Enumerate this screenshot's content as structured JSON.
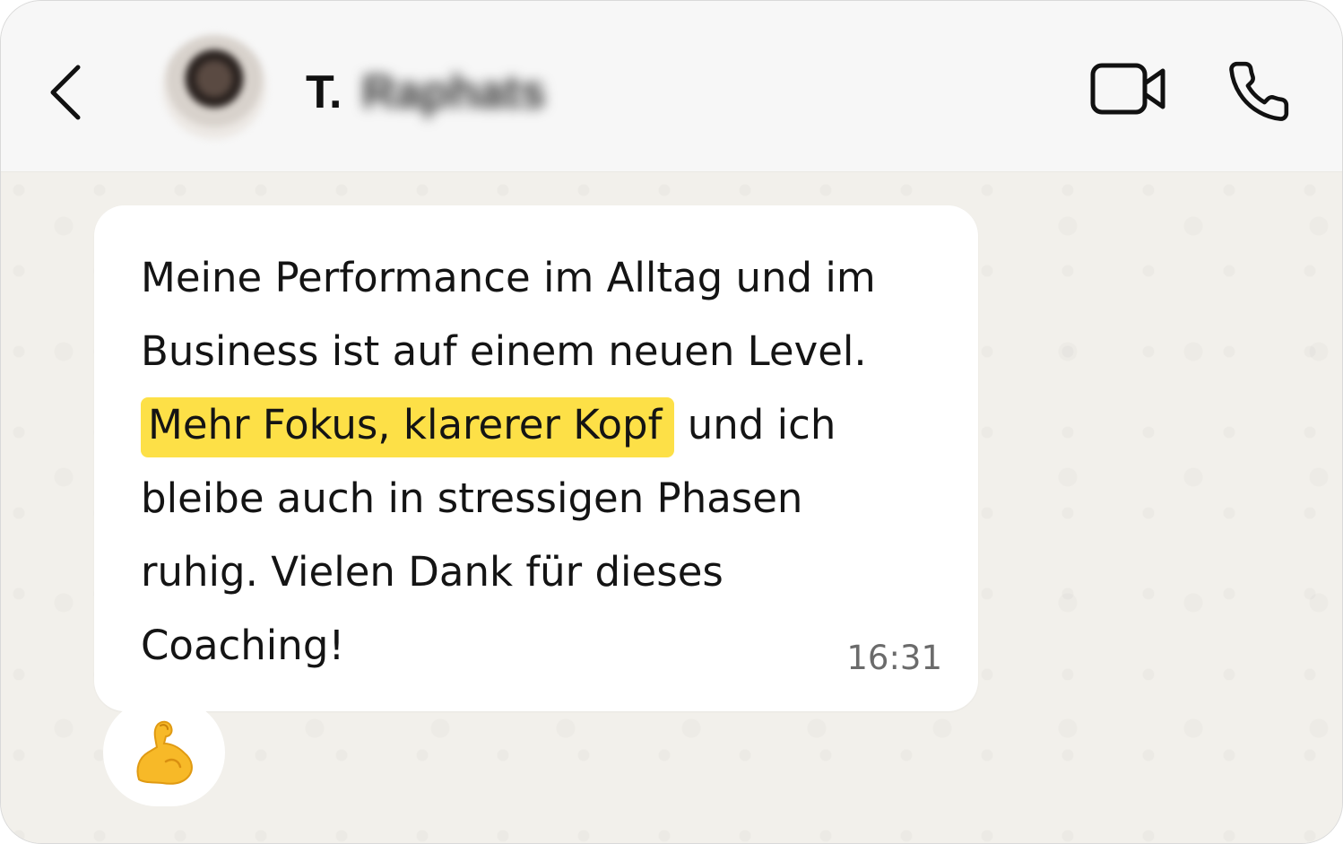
{
  "header": {
    "contact_initial": "T.",
    "contact_surname_blurred": "Raphats",
    "icons": {
      "back": "chevron-left-icon",
      "video": "video-camera-icon",
      "call": "phone-icon"
    }
  },
  "message": {
    "text_before": "Meine Performance im Alltag und im Business ist auf einem neuen Level. ",
    "highlight": "Mehr Fokus, klarerer Kopf",
    "text_after": " und ich bleibe auch in stressigen Phasen ruhig. Vielen Dank für dieses Coaching!",
    "time": "16:31",
    "highlight_color": "#fde047"
  },
  "reaction": {
    "emoji": "💪",
    "icon": "flexed-biceps-icon"
  }
}
